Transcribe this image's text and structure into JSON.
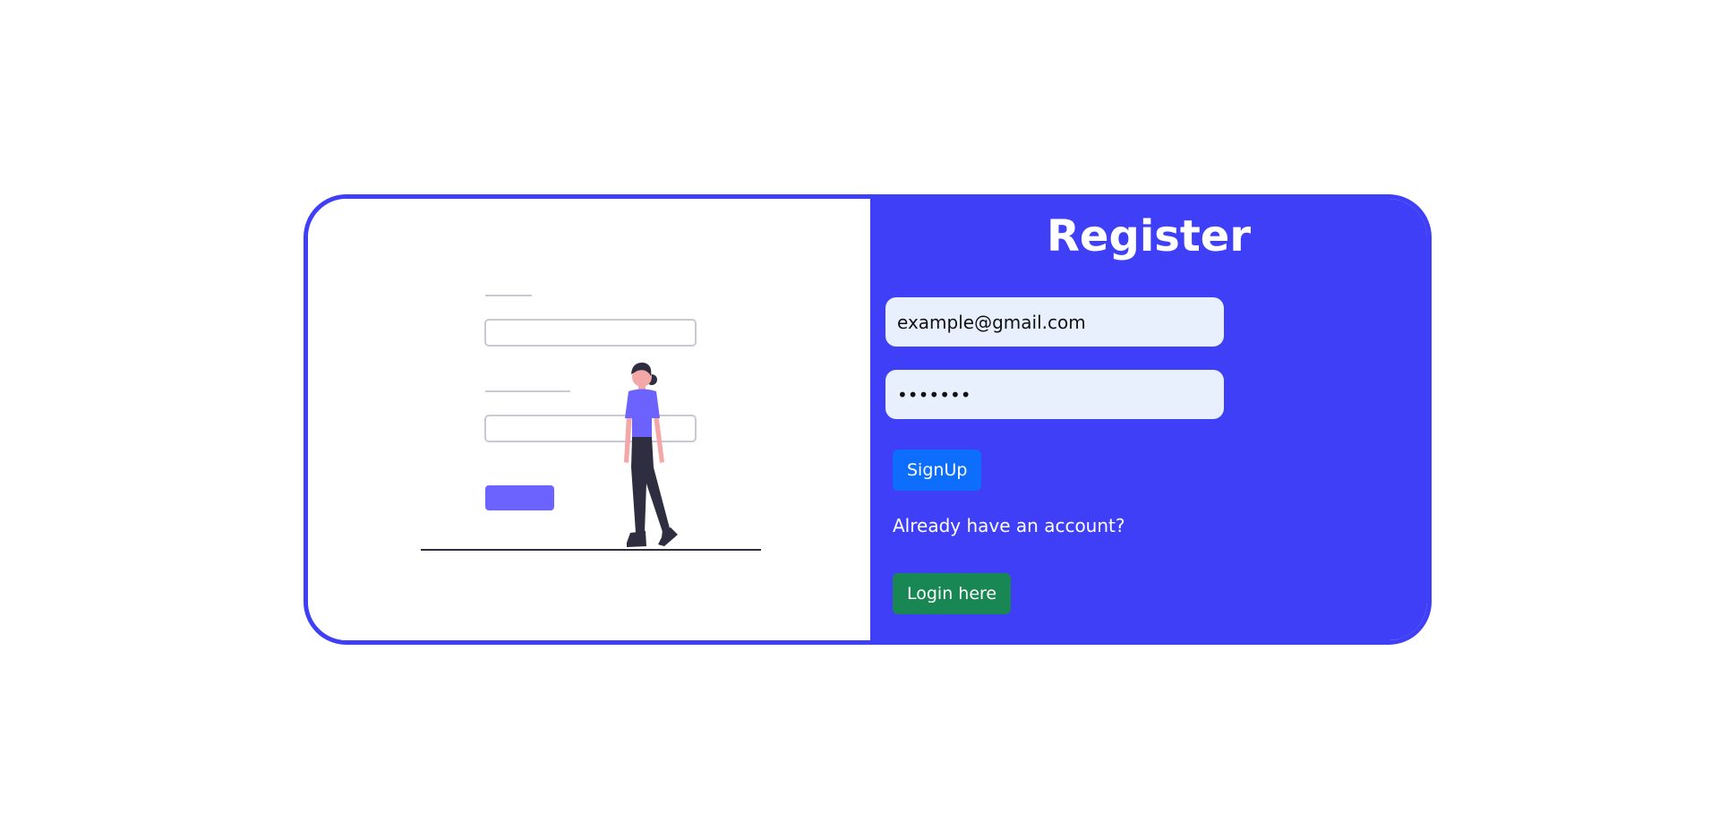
{
  "register": {
    "title": "Register",
    "email_value": "example@gmail.com",
    "password_value": "•••••••",
    "signup_label": "SignUp",
    "already_text": "Already have an account?",
    "login_label": "Login here"
  },
  "illustration": {
    "name": "person-with-login-form-illustration"
  },
  "colors": {
    "accent": "#3f3ff8",
    "signup_button": "#0d6efd",
    "login_button": "#198754",
    "input_bg": "#e8f0fe",
    "illustration_purple": "#6c63ff"
  }
}
